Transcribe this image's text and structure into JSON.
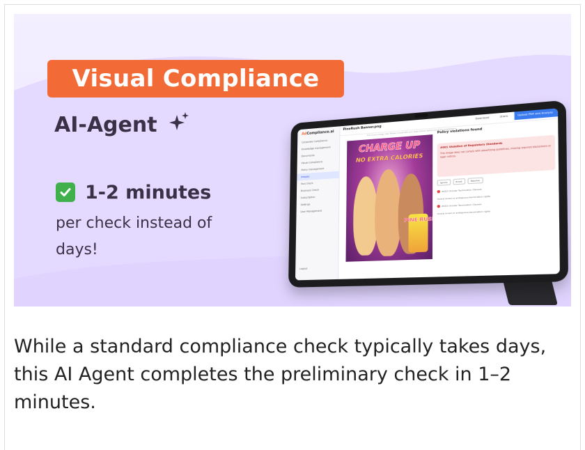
{
  "banner": {
    "title": "Visual Compliance",
    "subtitle": "AI-Agent",
    "minutes": "1-2 minutes",
    "per_check": "per check instead of days!",
    "icons": {
      "sparkle": "sparkle-icon",
      "check": "check-mark-icon"
    },
    "colors": {
      "title_bg": "#f26a35",
      "background": "#ede6ff",
      "check_bg": "#3fb04b",
      "text": "#3b3146"
    }
  },
  "tablet": {
    "app_logo_prefix": "Ad",
    "app_logo_suffix": "Compliance.ai",
    "sidebar_items": [
      "Corporate Compliance",
      "Knowledge management",
      "Documents",
      "Visual Compliance",
      "Policy management",
      "Images",
      "Fact check",
      "Business Check",
      "Subscription",
      "Settings",
      "User Management"
    ],
    "active_item": "Images",
    "logout": "Logout",
    "file_name": "PineRush Banner.png",
    "download": "Download",
    "share": "Share",
    "upload": "Upload PDF and Analyze",
    "hint": "This is your image view. Please consult with your legal advisor before use of any suggestions.",
    "poster_line1": "CHARGE UP",
    "poster_line2": "NO EXTRA CALORIES",
    "can_label": "PINE RUSH",
    "policy_title": "Policy violations found",
    "violation_title": "#001 Violation of Regulatory Standards",
    "violation_desc": "This image does not comply with advertising guidelines, missing required disclaimers or legal notices.",
    "pill_ignore": "Ignore",
    "pill_email": "Email",
    "pill_resolve": "Resolve",
    "clauses": [
      "#002 Unclear Termination Clauses",
      "#003 Unclear Termination Clauses"
    ],
    "clause_desc": "Overly broad or ambiguous termination rights"
  },
  "caption": "While a standard compliance check typically takes days, this AI Agent completes the preliminary check in 1–2 minutes."
}
